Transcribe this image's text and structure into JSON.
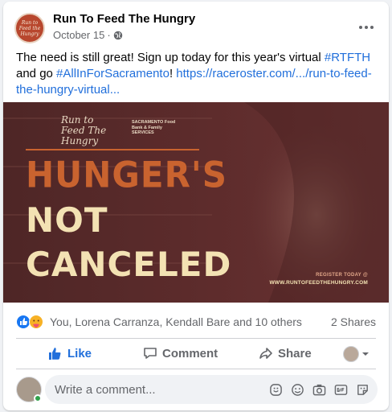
{
  "post": {
    "page_name": "Run To Feed The Hungry",
    "avatar_text": "Run to Feed the Hungry",
    "date": "October 15",
    "meta_separator": "·",
    "text_plain_1": "The need is still great! Sign up today for this year's virtual ",
    "hashtag_1": "#RTFTH",
    "text_plain_2": " and go ",
    "hashtag_2": "#AllInForSacramento",
    "text_plain_3": "! ",
    "link": "https://raceroster.com/.../run-to-feed-the-hungry-virtual..."
  },
  "media": {
    "logo_run": "Run to Feed The Hungry",
    "logo_sac": "SACRAMENTO Food Bank & Family SERVICES",
    "headline_1": "HUNGER'S",
    "headline_2": "NOT",
    "headline_3": "CANCELED",
    "register": "REGISTER TODAY @",
    "website": "WWW.RUNTOFEEDTHEHUNGRY.COM",
    "colors": {
      "accent": "#c9632f",
      "cream": "#f3e2b3",
      "overlay": "#5a2a2a"
    }
  },
  "reactions": {
    "names": "You, Lorena Carranza, Kendall Bare and 10 others",
    "shares": "2 Shares",
    "icons": [
      "like-reaction-icon",
      "care-reaction-icon"
    ]
  },
  "actions": {
    "like": "Like",
    "comment": "Comment",
    "share": "Share"
  },
  "composer": {
    "placeholder": "Write a comment...",
    "tools": [
      "sticker-icon",
      "emoji-icon",
      "camera-icon",
      "gif-icon",
      "avatar-sticker-icon"
    ]
  },
  "colors": {
    "link": "#216fdb",
    "muted": "#65676b",
    "online": "#31a24c"
  }
}
